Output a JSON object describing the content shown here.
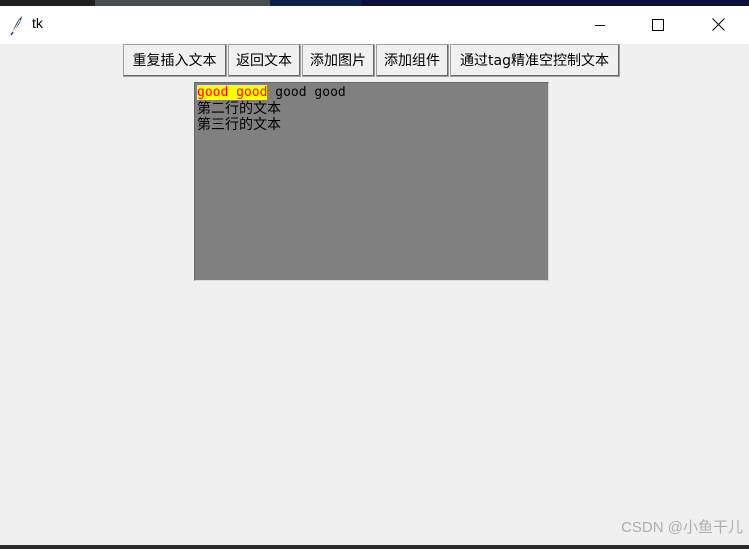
{
  "window": {
    "title": "tk",
    "controls": {
      "minimize": "minimize-icon",
      "maximize": "maximize-icon",
      "close": "close-icon"
    }
  },
  "toolbar": {
    "buttons": [
      {
        "label": "重复插入文本"
      },
      {
        "label": "返回文本"
      },
      {
        "label": "添加图片"
      },
      {
        "label": "添加组件"
      },
      {
        "label": "通过tag精准空控制文本"
      }
    ]
  },
  "text_widget": {
    "background": "#808080",
    "lines": [
      {
        "tagged": "good good",
        "rest": " good good"
      },
      {
        "text": "第二行的文本"
      },
      {
        "text": "第三行的文本"
      }
    ],
    "tag_style": {
      "background": "#ffff00",
      "foreground": "#ff0000"
    }
  },
  "watermark": "CSDN @小鱼干儿"
}
